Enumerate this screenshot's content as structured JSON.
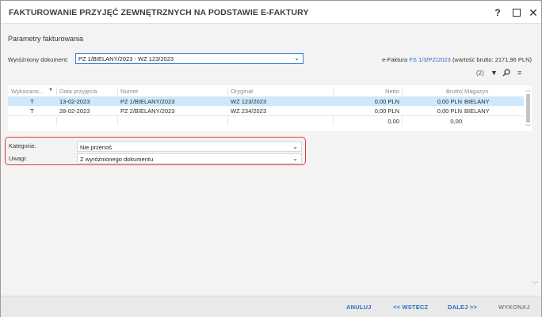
{
  "window": {
    "title": "FAKTUROWANIE PRZYJĘĆ ZEWNĘTRZNYCH NA PODSTAWIE E-FAKTURY",
    "help": "?",
    "maximize": "",
    "close": "✕"
  },
  "section_title": "Parametry fakturowania",
  "doc": {
    "label": "Wyróżniony dokument:",
    "value": "PZ 1/BIELANY/2023 - WZ 123/2023"
  },
  "efaktura": {
    "prefix": "e-Faktura",
    "link": "FS 1/3/PZ/2023",
    "suffix": "(wartość brutto: 2171,96 PLN)"
  },
  "grid_tools": {
    "count": "(2)"
  },
  "table": {
    "headers": [
      "Wykazano...",
      "Data przyjęcia",
      "Numer",
      "Oryginał",
      "Netto",
      "Brutto",
      "Magazyn"
    ],
    "rows": [
      [
        "T",
        "13-02-2023",
        "PZ 1/BIELANY/2023",
        "WZ 123/2023",
        "0,00 PLN",
        "0,00 PLN",
        "BIELANY"
      ],
      [
        "T",
        "28-02-2023",
        "PZ 2/BIELANY/2023",
        "WZ 234/2023",
        "0,00 PLN",
        "0,00 PLN",
        "BIELANY"
      ]
    ],
    "totals": {
      "netto": "0,00",
      "brutto": "0,00"
    }
  },
  "props": {
    "kategoria_label": "Kategoria:",
    "kategoria_value": "Nie przenoś",
    "uwagi_label": "Uwagi:",
    "uwagi_value": "Z wyróżnionego dokumentu"
  },
  "footer": {
    "cancel": "ANULUJ",
    "back": "<< WSTECZ",
    "next": "DALEJ >>",
    "execute": "WYKONAJ"
  },
  "colors": {
    "accent": "#2e6fc4",
    "selected_row": "#cfe8fb",
    "highlight_border": "#e0393d"
  }
}
